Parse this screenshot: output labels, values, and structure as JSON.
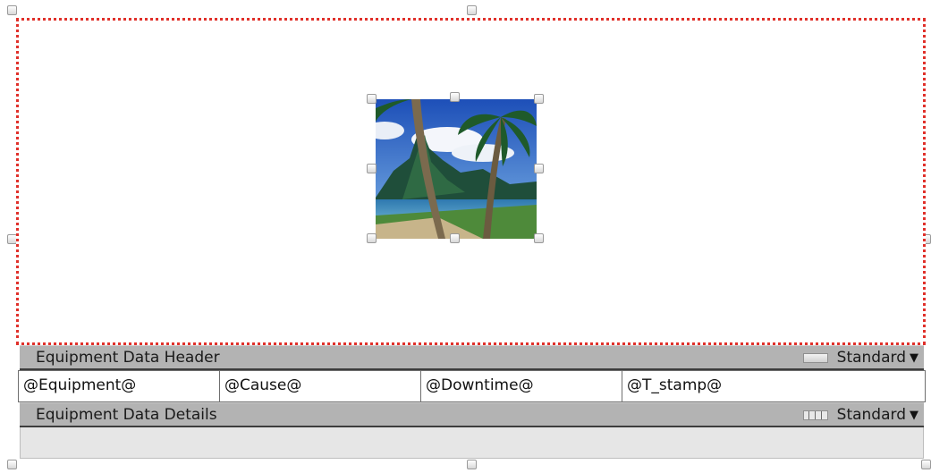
{
  "header_band": {
    "label": "Equipment Data Header",
    "style_label": "Standard",
    "icon": "band-bar-icon"
  },
  "fields": [
    "@Equipment@",
    "@Cause@",
    "@Downtime@",
    "@T_stamp@"
  ],
  "details_band": {
    "label": "Equipment Data Details",
    "style_label": "Standard",
    "icon": "band-columns-icon"
  },
  "colors": {
    "selection_border": "#e0302a",
    "band_background": "#b3b3b3",
    "details_background": "#e6e6e6"
  }
}
